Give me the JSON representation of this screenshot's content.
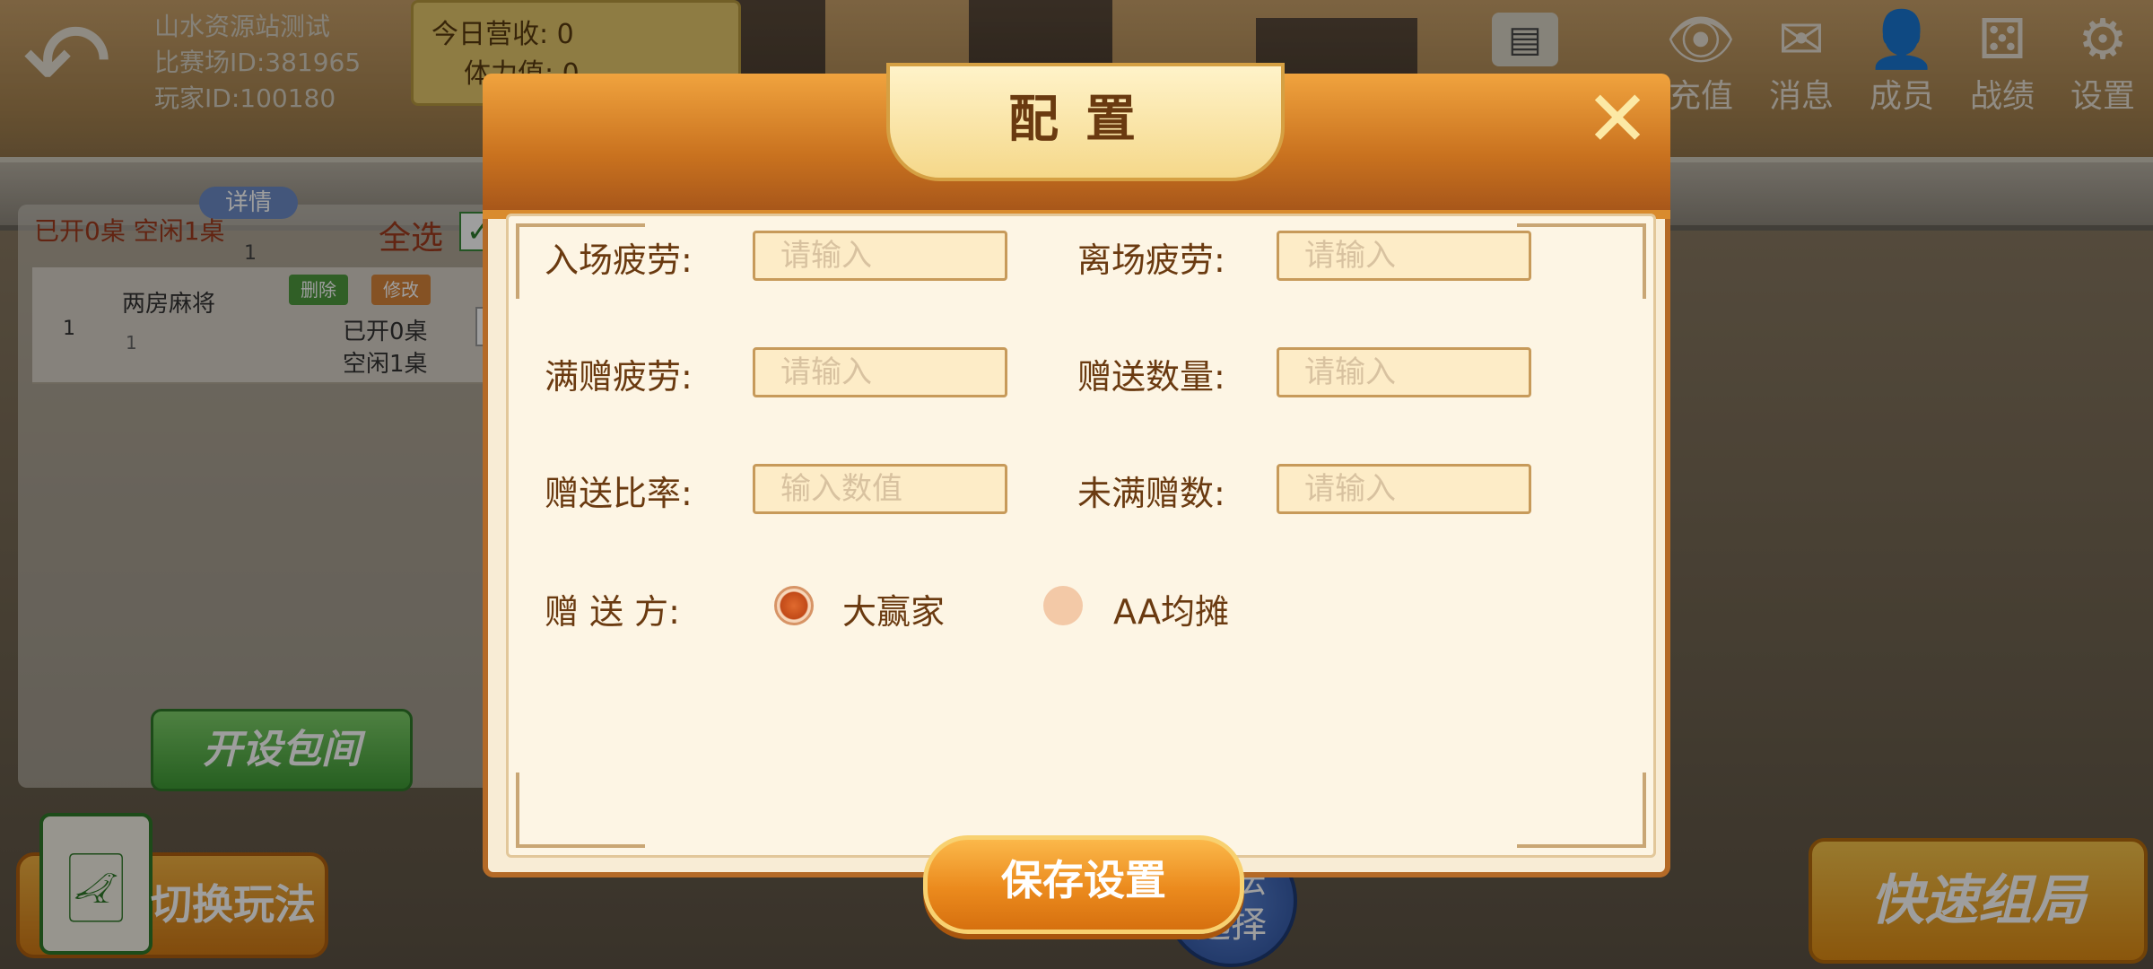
{
  "club": {
    "name": "山水资源站测试",
    "arena_id": "比赛场ID:381965",
    "player_id": "玩家ID:100180",
    "income_line": "今日营收: 0",
    "stamina_line": "体力值: 0"
  },
  "nav": {
    "card_label": "",
    "items": [
      {
        "icon": "eye-icon",
        "glyph": "👁",
        "label": "充值"
      },
      {
        "icon": "mail-icon",
        "glyph": "✉",
        "label": "消息"
      },
      {
        "icon": "member-icon",
        "glyph": "👤",
        "label": "成员"
      },
      {
        "icon": "dice-icon",
        "glyph": "⚄",
        "label": "战绩"
      },
      {
        "icon": "gear-icon",
        "glyph": "⚙",
        "label": "设置"
      }
    ]
  },
  "table_panel": {
    "status": "已开0桌  空闲1桌",
    "detail_tag": "详情",
    "detail_num": "1",
    "select_all": "全选",
    "rows": [
      {
        "index": "1",
        "name": "两房麻将",
        "sub": "1",
        "delete_label": "删除",
        "edit_label": "修改",
        "open_tables": "已开0桌",
        "idle_tables": "空闲1桌"
      }
    ],
    "open_room_label": "开设包间"
  },
  "bottom": {
    "switch_label": "切换玩法",
    "play_select_line1": "玩法",
    "play_select_line2": "选择",
    "quick_label": "快速组局"
  },
  "modal": {
    "title": "配置",
    "close_icon": "close-icon",
    "fields": {
      "enter_fatigue": {
        "label": "入场疲劳:",
        "placeholder": "请输入",
        "value": ""
      },
      "leave_fatigue": {
        "label": "离场疲劳:",
        "placeholder": "请输入",
        "value": ""
      },
      "full_gift_fatigue": {
        "label": "满赠疲劳:",
        "placeholder": "请输入",
        "value": ""
      },
      "gift_amount": {
        "label": "赠送数量:",
        "placeholder": "请输入",
        "value": ""
      },
      "gift_rate": {
        "label": "赠送比率:",
        "placeholder": "输入数值",
        "value": ""
      },
      "unfull_gift": {
        "label": "未满赠数:",
        "placeholder": "请输入",
        "value": ""
      }
    },
    "gift_to": {
      "label": "赠 送 方:",
      "options": [
        "大赢家",
        "AA均摊"
      ],
      "selected": "大赢家"
    },
    "save_label": "保存设置"
  }
}
